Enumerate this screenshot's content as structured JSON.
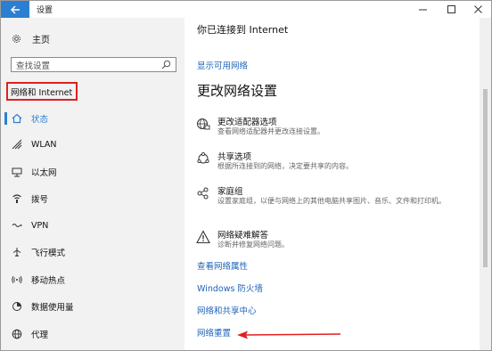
{
  "window": {
    "title": "设置"
  },
  "sidebar": {
    "home_label": "主页",
    "search_placeholder": "查找设置",
    "section_title": "网络和 Internet",
    "items": [
      {
        "label": "状态",
        "icon": "home-icon",
        "active": true
      },
      {
        "label": "WLAN",
        "icon": "wifi-icon"
      },
      {
        "label": "以太网",
        "icon": "ethernet-icon"
      },
      {
        "label": "拨号",
        "icon": "dialup-icon"
      },
      {
        "label": "VPN",
        "icon": "vpn-icon"
      },
      {
        "label": "飞行模式",
        "icon": "airplane-icon"
      },
      {
        "label": "移动热点",
        "icon": "hotspot-icon"
      },
      {
        "label": "数据使用量",
        "icon": "data-usage-icon"
      },
      {
        "label": "代理",
        "icon": "globe-icon"
      }
    ]
  },
  "main": {
    "connected_text": "你已连接到 Internet",
    "show_networks_link": "显示可用网络",
    "change_heading": "更改网络设置",
    "options": [
      {
        "title": "更改适配器选项",
        "desc": "查看网络适配器并更改连接设置。",
        "icon": "adapter-icon"
      },
      {
        "title": "共享选项",
        "desc": "根据所连接到的网络，决定要共享的内容。",
        "icon": "sharing-icon"
      },
      {
        "title": "家庭组",
        "desc": "设置家庭组，以便与网络上的其他电脑共享图片、音乐、文件和打印机。",
        "icon": "homegroup-icon"
      },
      {
        "title": "网络疑难解答",
        "desc": "诊断并修复网络问题。",
        "icon": "warning-icon"
      }
    ],
    "links": [
      "查看网络属性",
      "Windows 防火墙",
      "网络和共享中心",
      "网络重置"
    ]
  },
  "colors": {
    "accent": "#2b7fd3",
    "link": "#1f63b8",
    "highlight": "#e0201f"
  }
}
